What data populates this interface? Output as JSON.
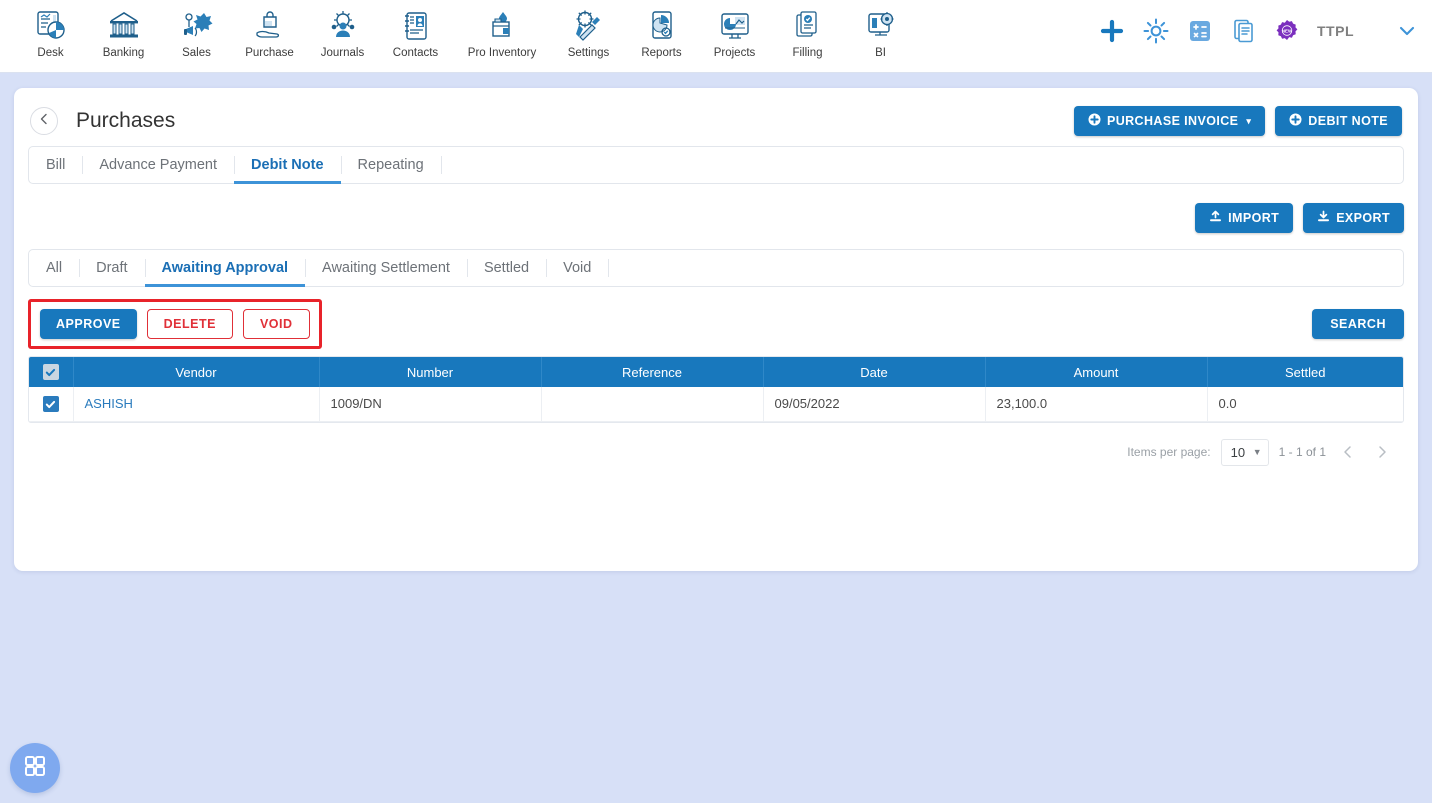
{
  "topnav": {
    "modules": [
      {
        "label": "Desk",
        "icon": "desk-dashboard-icon"
      },
      {
        "label": "Banking",
        "icon": "bank-building-icon"
      },
      {
        "label": "Sales",
        "icon": "sales-megaphone-icon"
      },
      {
        "label": "Purchase",
        "icon": "purchase-bag-hand-icon"
      },
      {
        "label": "Journals",
        "icon": "journals-people-gear-icon"
      },
      {
        "label": "Contacts",
        "icon": "contacts-book-icon"
      },
      {
        "label": "Pro Inventory",
        "icon": "pro-inventory-box-icon"
      },
      {
        "label": "Settings",
        "icon": "settings-tools-icon"
      },
      {
        "label": "Reports",
        "icon": "reports-piechart-icon"
      },
      {
        "label": "Projects",
        "icon": "projects-board-icon"
      },
      {
        "label": "Filling",
        "icon": "filling-documents-icon"
      },
      {
        "label": "BI",
        "icon": "bi-monitor-gear-icon"
      }
    ],
    "right_icons": [
      {
        "name": "add-plus-icon"
      },
      {
        "name": "gear-settings-icon"
      },
      {
        "name": "calculator-icon"
      },
      {
        "name": "notes-document-icon"
      },
      {
        "name": "new-badge-icon",
        "text": "NEW"
      }
    ],
    "org_name": "TTPL",
    "profile_caret": "chevron-down-icon"
  },
  "header": {
    "back_icon": "chevron-left-icon",
    "title": "Purchases",
    "purchase_invoice_label": "PURCHASE INVOICE",
    "purchase_invoice_caret": "▾",
    "debit_note_label": "DEBIT NOTE"
  },
  "doc_tabs": [
    {
      "label": "Bill",
      "active": false
    },
    {
      "label": "Advance Payment",
      "active": false
    },
    {
      "label": "Debit Note",
      "active": true
    },
    {
      "label": "Repeating",
      "active": false
    }
  ],
  "io_buttons": {
    "import_label": "IMPORT",
    "export_label": "EXPORT"
  },
  "status_tabs": [
    {
      "label": "All",
      "active": false
    },
    {
      "label": "Draft",
      "active": false
    },
    {
      "label": "Awaiting Approval",
      "active": true
    },
    {
      "label": "Awaiting Settlement",
      "active": false
    },
    {
      "label": "Settled",
      "active": false
    },
    {
      "label": "Void",
      "active": false
    }
  ],
  "actions": {
    "approve_label": "APPROVE",
    "delete_label": "DELETE",
    "void_label": "VOID",
    "search_label": "SEARCH",
    "highlight_color": "#e8232a"
  },
  "table": {
    "columns": [
      "Vendor",
      "Number",
      "Reference",
      "Date",
      "Amount",
      "Settled"
    ],
    "select_all_checked": true,
    "rows": [
      {
        "checked": true,
        "vendor": "ASHISH",
        "number": "1009/DN",
        "reference": "",
        "date": "09/05/2022",
        "amount": "23,100.0",
        "settled": "0.0"
      }
    ]
  },
  "pagination": {
    "items_per_page_label": "Items per page:",
    "items_per_page_value": "10",
    "range_text": "1 - 1 of 1",
    "prev_icon": "chevron-left-icon",
    "next_icon": "chevron-right-icon"
  },
  "fab": {
    "icon": "grid-apps-icon"
  },
  "colors": {
    "primary_blue": "#1878bd",
    "accent_blue": "#3d93d8",
    "danger_red": "#e03038",
    "page_bg": "#d7e0f7"
  }
}
